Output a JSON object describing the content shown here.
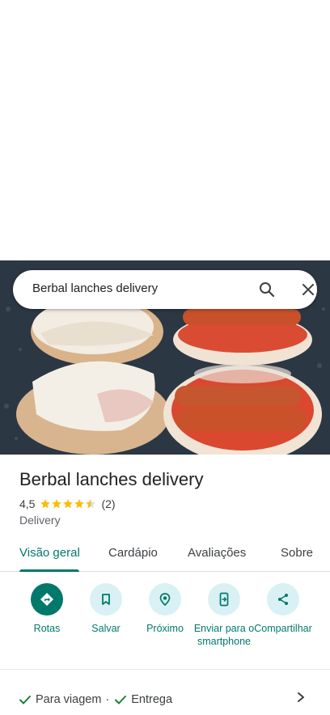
{
  "search": {
    "query": "Berbal lanches delivery"
  },
  "place": {
    "title": "Berbal lanches delivery",
    "rating": "4,5",
    "reviews_count": "(2)",
    "stars": 4.5,
    "category": "Delivery"
  },
  "tabs": [
    {
      "label": "Visão geral",
      "active": true
    },
    {
      "label": "Cardápio"
    },
    {
      "label": "Avaliações"
    },
    {
      "label": "Sobre"
    }
  ],
  "actions": [
    {
      "label": "Rotas",
      "icon": "directions-icon"
    },
    {
      "label": "Salvar",
      "icon": "bookmark-icon"
    },
    {
      "label": "Próximo",
      "icon": "nearby-icon"
    },
    {
      "label": "Enviar para o smartphone",
      "icon": "send-to-phone-icon"
    },
    {
      "label": "Compartilhar",
      "icon": "share-icon"
    }
  ],
  "services": {
    "takeout": "Para viagem",
    "separator": "·",
    "delivery": "Entrega"
  },
  "colors": {
    "accent": "#00796b",
    "action_bg": "#d9f1f4",
    "star": "#fbbc04"
  }
}
